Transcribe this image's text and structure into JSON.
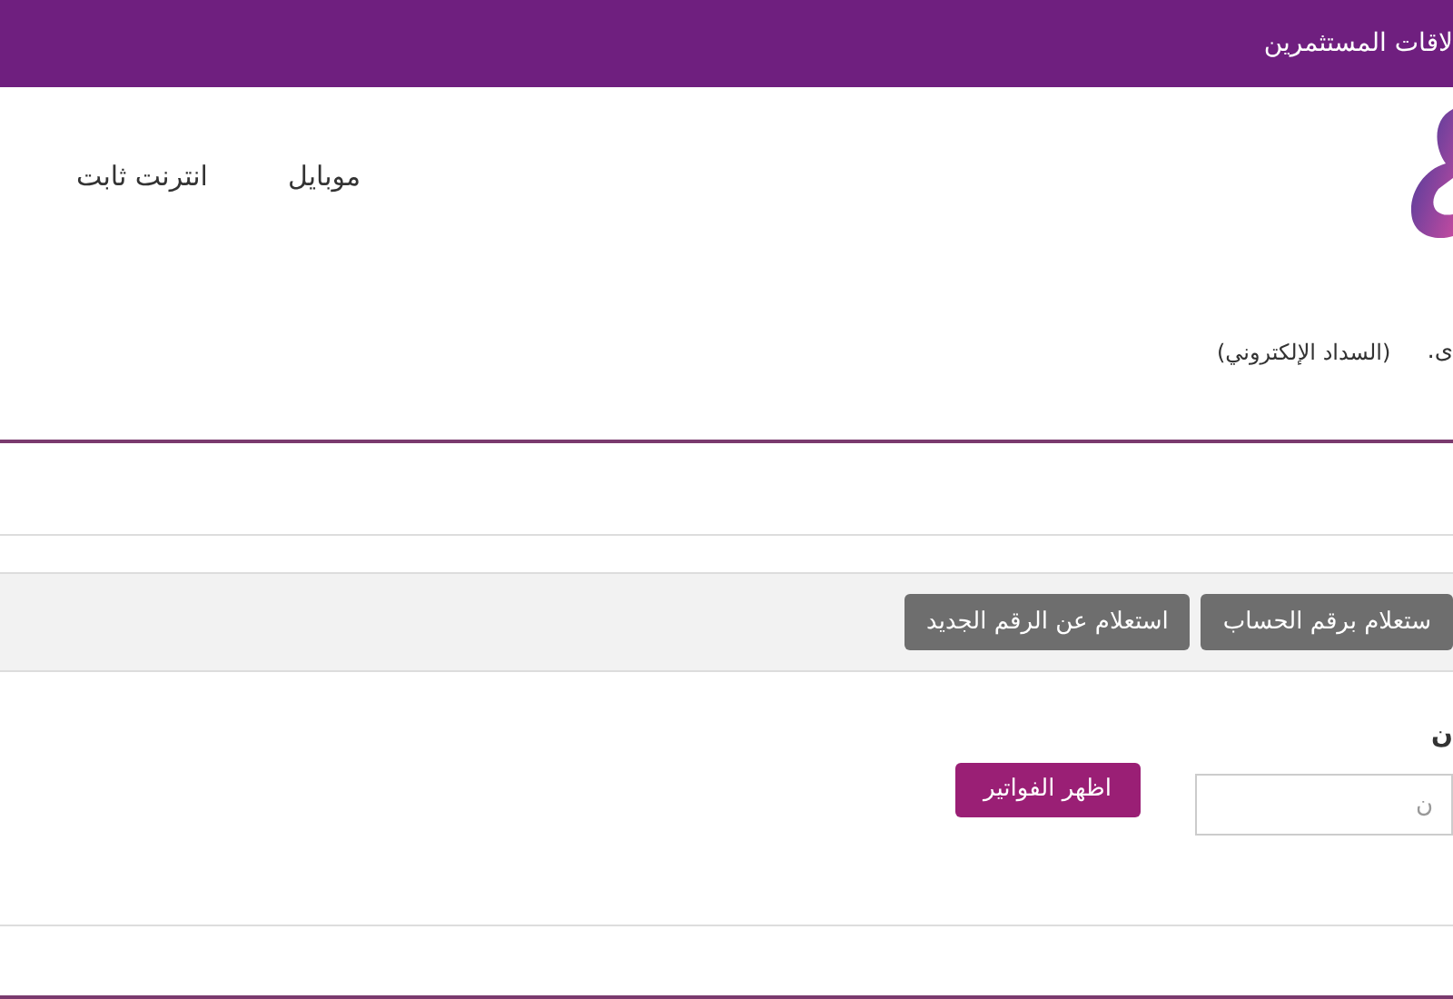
{
  "top_bar": {
    "title": "لاقات المستثمرين"
  },
  "nav": {
    "items": [
      {
        "label": "موبايل"
      },
      {
        "label": "انترنت ثابت"
      }
    ]
  },
  "intro": {
    "fragment": "ى.",
    "note": "(السداد الإلكتروني)"
  },
  "tabs": [
    {
      "label": "ستعلام برقم الحساب",
      "selected": false
    },
    {
      "label": "استعلام عن الرقم الجديد",
      "selected": false
    }
  ],
  "form": {
    "label": "ن",
    "placeholder": "ن",
    "button": "اظهر الفواتير"
  }
}
